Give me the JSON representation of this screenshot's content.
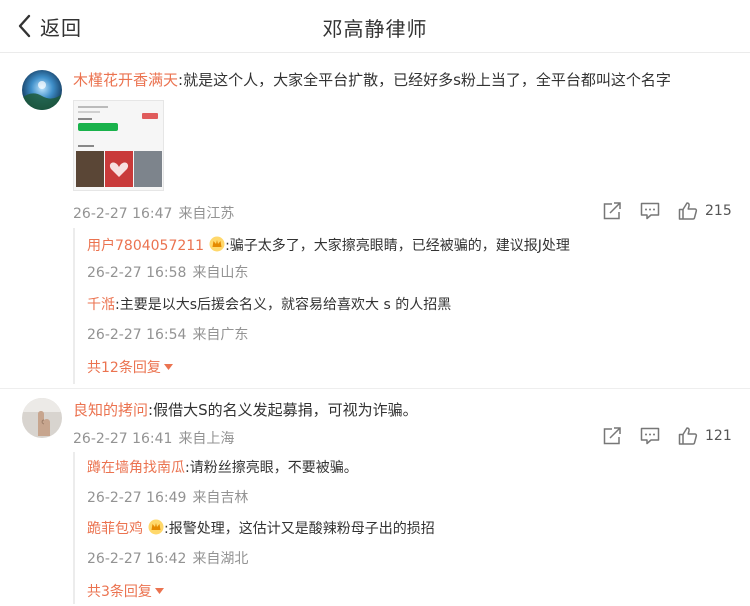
{
  "header": {
    "back_label": "返回",
    "title": "邓高静律师"
  },
  "comments": [
    {
      "username": "木槿花开香满天",
      "text": "就是这个人，大家全平台扩散，已经好多s粉上当了，全平台都叫这个名字",
      "date": "26-2-27 16:47",
      "location": "来自江苏",
      "likes": "215",
      "replies": [
        {
          "username": "用户7804057211",
          "text": "骗子太多了，大家擦亮眼睛，已经被骗的，建议报J处理",
          "date": "26-2-27 16:58",
          "location": "来自山东"
        },
        {
          "username": "千湉",
          "text": "主要是以大s后援会名义，就容易给喜欢大 s 的人招黑",
          "date": "26-2-27 16:54",
          "location": "来自广东"
        }
      ],
      "more_replies": "共12条回复"
    },
    {
      "username": "良知的拷问",
      "text": "假借大S的名义发起募捐，可视为诈骗。",
      "date": "26-2-27 16:41",
      "location": "来自上海",
      "likes": "121",
      "replies": [
        {
          "username": "蹲在墙角找南瓜",
          "text": "请粉丝擦亮眼，不要被骗。",
          "date": "26-2-27 16:49",
          "location": "来自吉林"
        },
        {
          "username": "跪菲包鸡",
          "text": "报警处理，这估计又是酸辣粉母子出的损招",
          "date": "26-2-27 16:42",
          "location": "来自湖北"
        }
      ],
      "more_replies": "共3条回复"
    }
  ],
  "colors": {
    "username": "#eb7350",
    "meta": "#939393",
    "text": "#333333"
  }
}
